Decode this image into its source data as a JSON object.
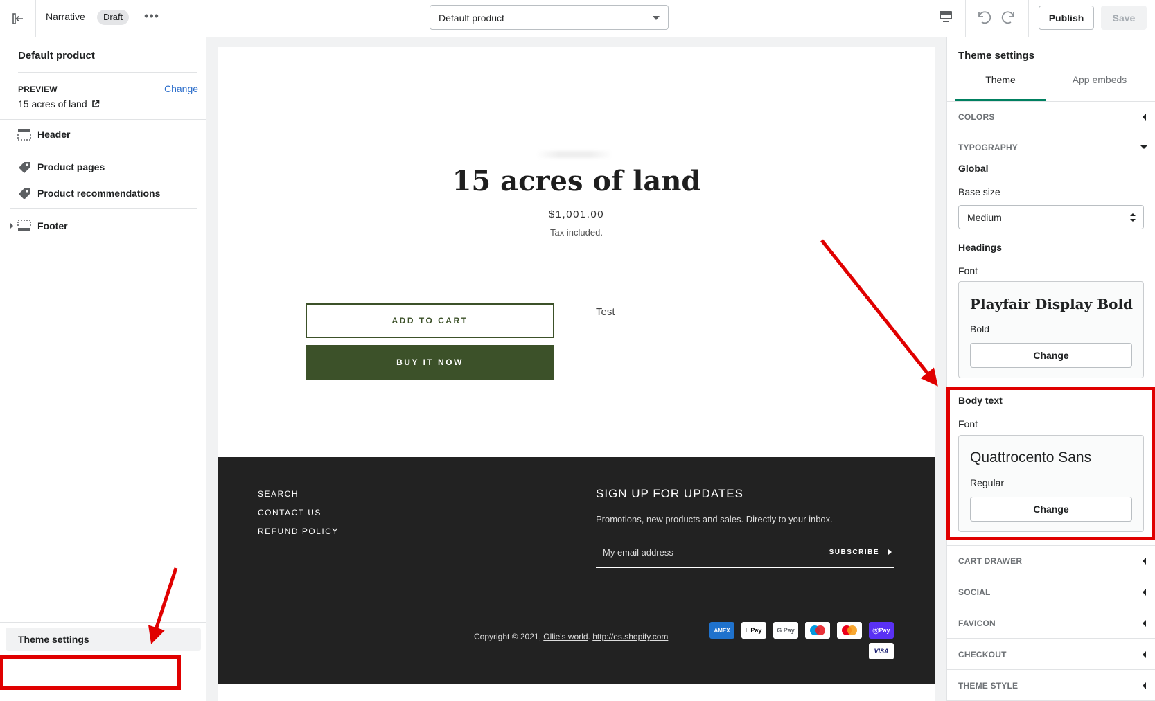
{
  "topbar": {
    "theme_name": "Narrative",
    "status_badge": "Draft",
    "page_select_value": "Default product",
    "publish_label": "Publish",
    "save_label": "Save"
  },
  "left_panel": {
    "title": "Default product",
    "preview_label": "PREVIEW",
    "preview_change": "Change",
    "preview_value": "15 acres of land",
    "sections": {
      "header": "Header",
      "product_pages": "Product pages",
      "product_recommendations": "Product recommendations",
      "footer": "Footer"
    },
    "theme_settings": "Theme settings"
  },
  "preview": {
    "product_title": "15 acres of land",
    "price": "$1,001.00",
    "tax_note": "Tax included.",
    "add_to_cart": "ADD TO CART",
    "buy_now": "BUY IT NOW",
    "description": "Test",
    "footer": {
      "links": [
        "SEARCH",
        "CONTACT US",
        "REFUND POLICY"
      ],
      "signup_title": "SIGN UP FOR UPDATES",
      "signup_sub": "Promotions, new products and sales. Directly to your inbox.",
      "email_placeholder": "My email address",
      "subscribe": "SUBSCRIBE",
      "copyright_prefix": "Copyright © 2021, ",
      "copyright_store": "Ollie's world",
      "copyright_sep": ". ",
      "copyright_link": "http://es.shopify.com",
      "payment_methods": [
        "AMEX",
        "Pay",
        "G Pay",
        "Maestro",
        "Mastercard",
        "Pay",
        "VISA"
      ]
    }
  },
  "right_panel": {
    "title": "Theme settings",
    "tabs": [
      "Theme",
      "App embeds"
    ],
    "colors": "COLORS",
    "typography": "TYPOGRAPHY",
    "global": "Global",
    "base_size_label": "Base size",
    "base_size_value": "Medium",
    "headings": "Headings",
    "headings_font_label": "Font",
    "headings_font": "Playfair Display Bold",
    "headings_style": "Bold",
    "headings_change": "Change",
    "body_text": "Body text",
    "body_font_label": "Font",
    "body_font": "Quattrocento Sans",
    "body_style": "Regular",
    "body_change": "Change",
    "collapsed_sections": [
      "CART DRAWER",
      "SOCIAL",
      "FAVICON",
      "CHECKOUT",
      "THEME STYLE"
    ]
  },
  "colors": {
    "accent_green": "#3c5129",
    "highlight_red": "#e00000",
    "tab_underline": "#008060"
  }
}
